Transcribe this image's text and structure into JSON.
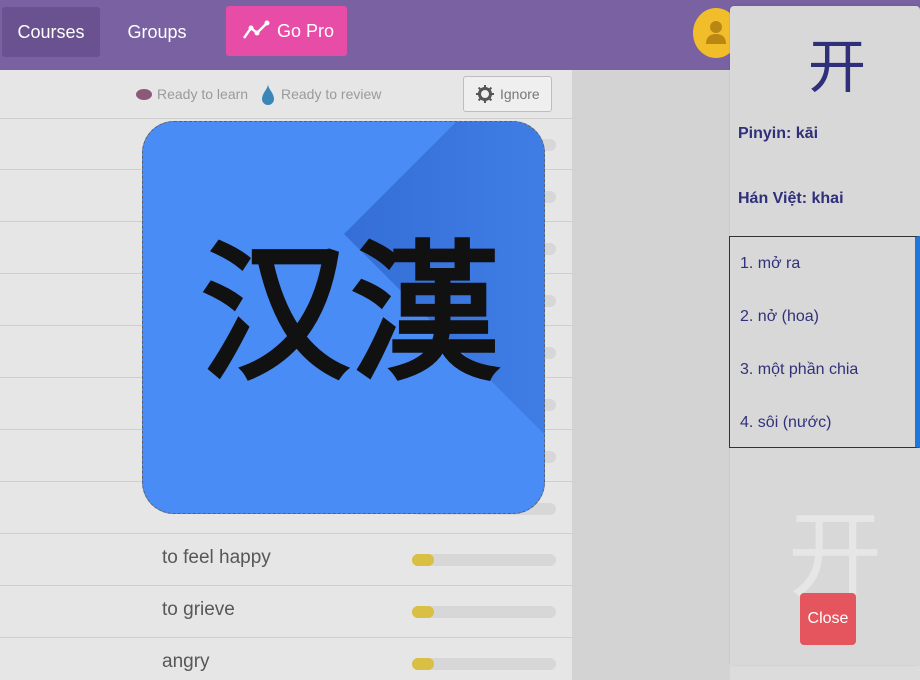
{
  "header": {
    "nav_courses": "Courses",
    "nav_groups": "Groups",
    "go_pro": "Go Pro"
  },
  "toolbar": {
    "ready_to_learn": "Ready to learn",
    "ready_to_review": "Ready to review",
    "ignore": "Ignore"
  },
  "logo": {
    "text": "汉漢"
  },
  "rows": [
    {
      "label": "to feel happy",
      "progress": 0.15
    },
    {
      "label": "to grieve",
      "progress": 0.15
    },
    {
      "label": "angry",
      "progress": 0.15
    }
  ],
  "detail": {
    "character": "开",
    "pinyin": "Pinyin: kāi",
    "han_viet": "Hán Việt: khai",
    "meanings": [
      "1. mở ra",
      "2. nở (hoa)",
      "3. một phần chia",
      "4. sôi (nước)"
    ],
    "ghost_character": "开",
    "close": "Close"
  },
  "colors": {
    "header": "#7a61a2",
    "pro": "#e74da7",
    "avatar": "#f2bd2b",
    "progress": "#d9bf43",
    "close": "#e5555d",
    "meaning_border": "#1f76df",
    "logo": "#4a8cf5"
  }
}
